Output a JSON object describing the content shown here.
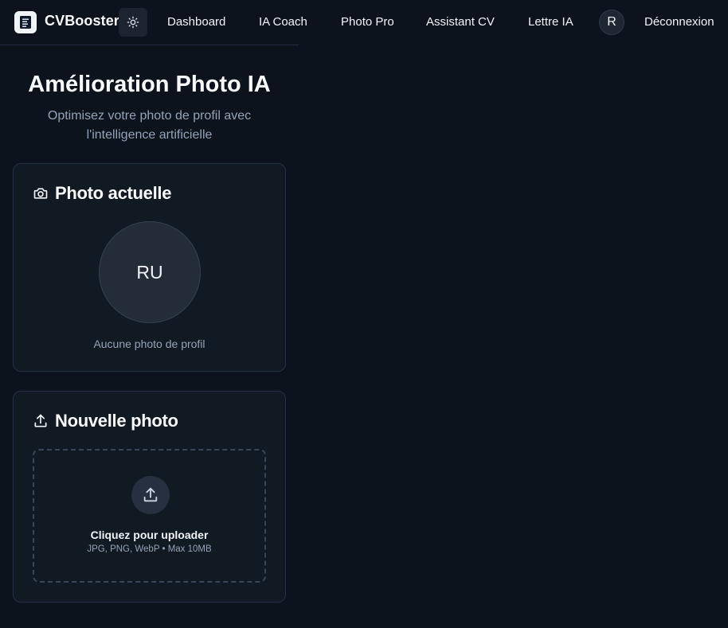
{
  "header": {
    "brand": "CVBooster",
    "nav": [
      "Dashboard",
      "IA Coach",
      "Photo Pro",
      "Assistant CV",
      "Lettre IA"
    ],
    "avatar_initial": "R",
    "logout_label": "Déconnexion"
  },
  "page": {
    "title": "Amélioration Photo IA",
    "subtitle": "Optimisez votre photo de profil avec l'intelligence artificielle"
  },
  "current_photo": {
    "title": "Photo actuelle",
    "initials": "RU",
    "empty_text": "Aucune photo de profil"
  },
  "new_photo": {
    "title": "Nouvelle photo",
    "upload_label": "Cliquez pour uploader",
    "upload_hint": "JPG, PNG, WebP • Max 10MB"
  },
  "icons": {
    "logo": "document-icon",
    "theme": "sun-icon",
    "current_photo": "camera-icon",
    "new_photo": "upload-icon"
  },
  "colors": {
    "background": "#0d131c",
    "card": "#111923",
    "border": "#263243",
    "muted_text": "#94a3b8"
  }
}
